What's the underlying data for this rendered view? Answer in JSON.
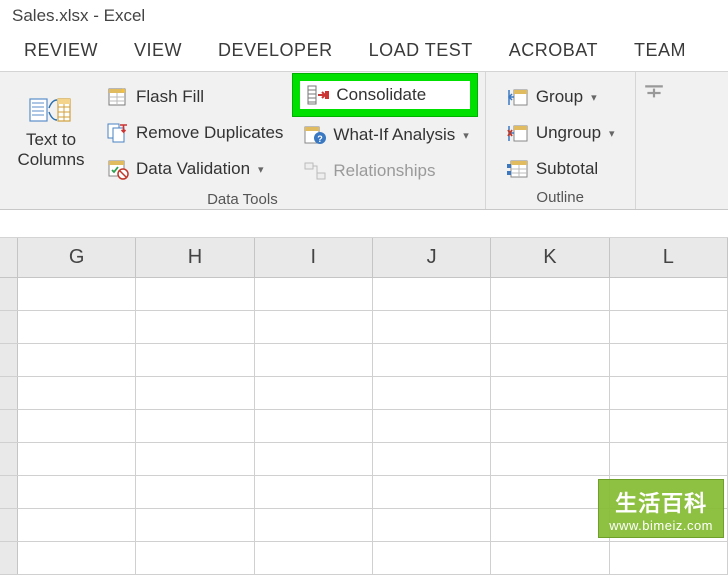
{
  "title": "Sales.xlsx - Excel",
  "tabs": [
    "REVIEW",
    "VIEW",
    "DEVELOPER",
    "LOAD TEST",
    "ACROBAT",
    "TEAM"
  ],
  "ribbon": {
    "text_to_columns": "Text to Columns",
    "flash_fill": "Flash Fill",
    "remove_duplicates": "Remove Duplicates",
    "data_validation": "Data Validation",
    "consolidate": "Consolidate",
    "what_if": "What-If Analysis",
    "relationships": "Relationships",
    "group_data_tools": "Data Tools",
    "group_cmd": "Group",
    "ungroup": "Ungroup",
    "subtotal": "Subtotal",
    "group_outline": "Outline"
  },
  "columns": [
    "G",
    "H",
    "I",
    "J",
    "K",
    "L"
  ],
  "watermark": {
    "title": "生活百科",
    "url": "www.bimeiz.com"
  }
}
